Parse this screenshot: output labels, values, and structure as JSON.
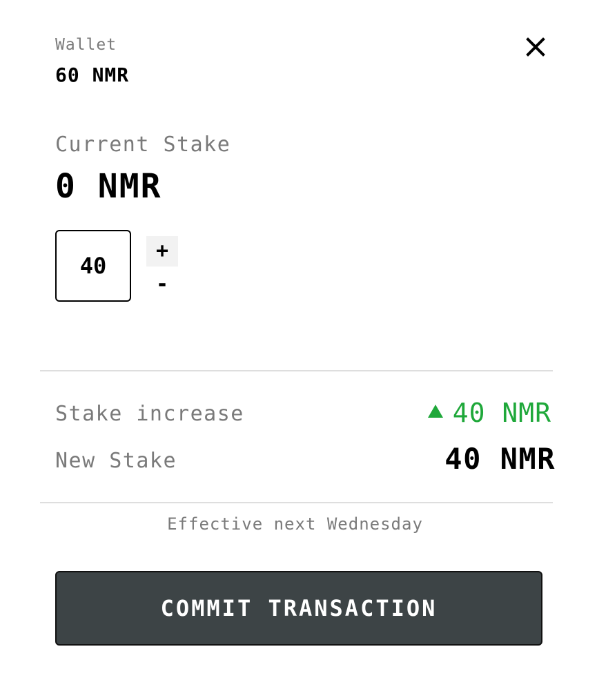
{
  "wallet": {
    "label": "Wallet",
    "balance": "60 NMR"
  },
  "close_icon": "close-icon",
  "current_stake": {
    "label": "Current Stake",
    "value": "0 NMR"
  },
  "stepper": {
    "amount": "40",
    "plus_label": "+",
    "minus_label": "-"
  },
  "summary": {
    "increase_label": "Stake increase",
    "increase_value": "40 NMR",
    "increase_icon": "arrow-up-icon",
    "increase_color": "#1fa83a",
    "new_stake_label": "New Stake",
    "new_stake_value": "40 NMR"
  },
  "effective_note": "Effective next Wednesday",
  "commit_button": {
    "label": "COMMIT TRANSACTION",
    "color": "#3d4446"
  }
}
